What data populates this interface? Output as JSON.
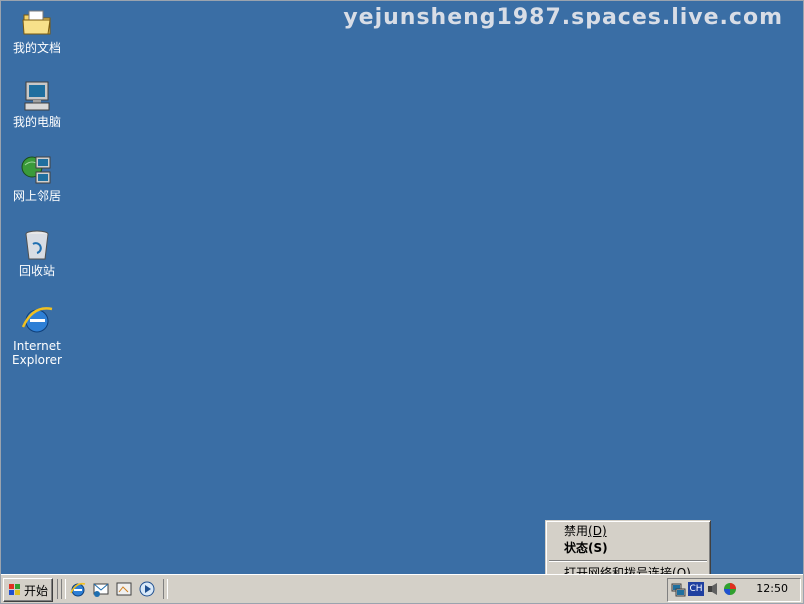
{
  "watermark": "yejunsheng1987.spaces.live.com",
  "desktop_icons": [
    {
      "label": "我的文档",
      "icon": "my-documents-folder-icon"
    },
    {
      "label": "我的电脑",
      "icon": "my-computer-icon"
    },
    {
      "label": "网上邻居",
      "icon": "network-places-icon"
    },
    {
      "label": "回收站",
      "icon": "recycle-bin-icon"
    },
    {
      "label_line1": "Internet",
      "label_line2": "Explorer",
      "icon": "internet-explorer-icon"
    }
  ],
  "taskbar": {
    "start_label": "开始",
    "quick_launch": [
      "internet-explorer-icon",
      "outlook-express-icon",
      "show-desktop-icon",
      "media-player-icon"
    ],
    "tray_icons": [
      "network-connection-icon",
      "language-ch-icon",
      "volume-icon",
      "update-icon"
    ],
    "language_label": "CH",
    "clock": "12:50"
  },
  "context_menu": {
    "items": [
      {
        "label": "禁用",
        "accel": "(D)",
        "bold": false
      },
      {
        "label": "状态",
        "accel": "(S)",
        "bold": true
      },
      {
        "label": "打开网络和拨号连接",
        "accel": "(O)",
        "bold": false
      }
    ]
  },
  "colors": {
    "desktop": "#3a6ea5",
    "taskbar": "#d4d0c8"
  }
}
